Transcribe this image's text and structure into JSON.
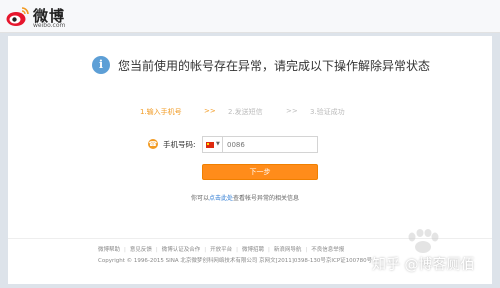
{
  "brand": {
    "name": "微博",
    "domain": "weibo.com"
  },
  "notice": {
    "icon": "i",
    "message": "您当前使用的帐号存在异常，请完成以下操作解除异常状态"
  },
  "steps": [
    {
      "label": "1.输入手机号",
      "state": "active"
    },
    {
      "label": ">>",
      "state": "active"
    },
    {
      "label": "2.发送短信",
      "state": "inactive"
    },
    {
      "label": ">>",
      "state": "inactive"
    },
    {
      "label": "3.验证成功",
      "state": "inactive"
    }
  ],
  "form": {
    "phone_label": "手机号码:",
    "country_flag": "china-flag-icon",
    "phone_placeholder": "0086",
    "submit_label": "下一步"
  },
  "help": {
    "prefix": "你可以",
    "link": "点击此处",
    "suffix": "查看帐号异常的相关信息"
  },
  "footer": {
    "links": [
      "微博帮助",
      "意见反馈",
      "微博认证及合作",
      "开放平台",
      "微博招聘",
      "新浪网导航",
      "不良信息举报"
    ],
    "copyright": "Copyright © 1996-2015 SINA 北京微梦创科网络技术有限公司  京网文[2011]0398-130号京ICP证100780号"
  },
  "watermark": {
    "text": "知乎 @博客厕佰"
  },
  "colors": {
    "accent": "#f29b23",
    "button": "#ff8c1a",
    "link": "#2c7ad3",
    "notice_icon": "#5d9fd6"
  }
}
